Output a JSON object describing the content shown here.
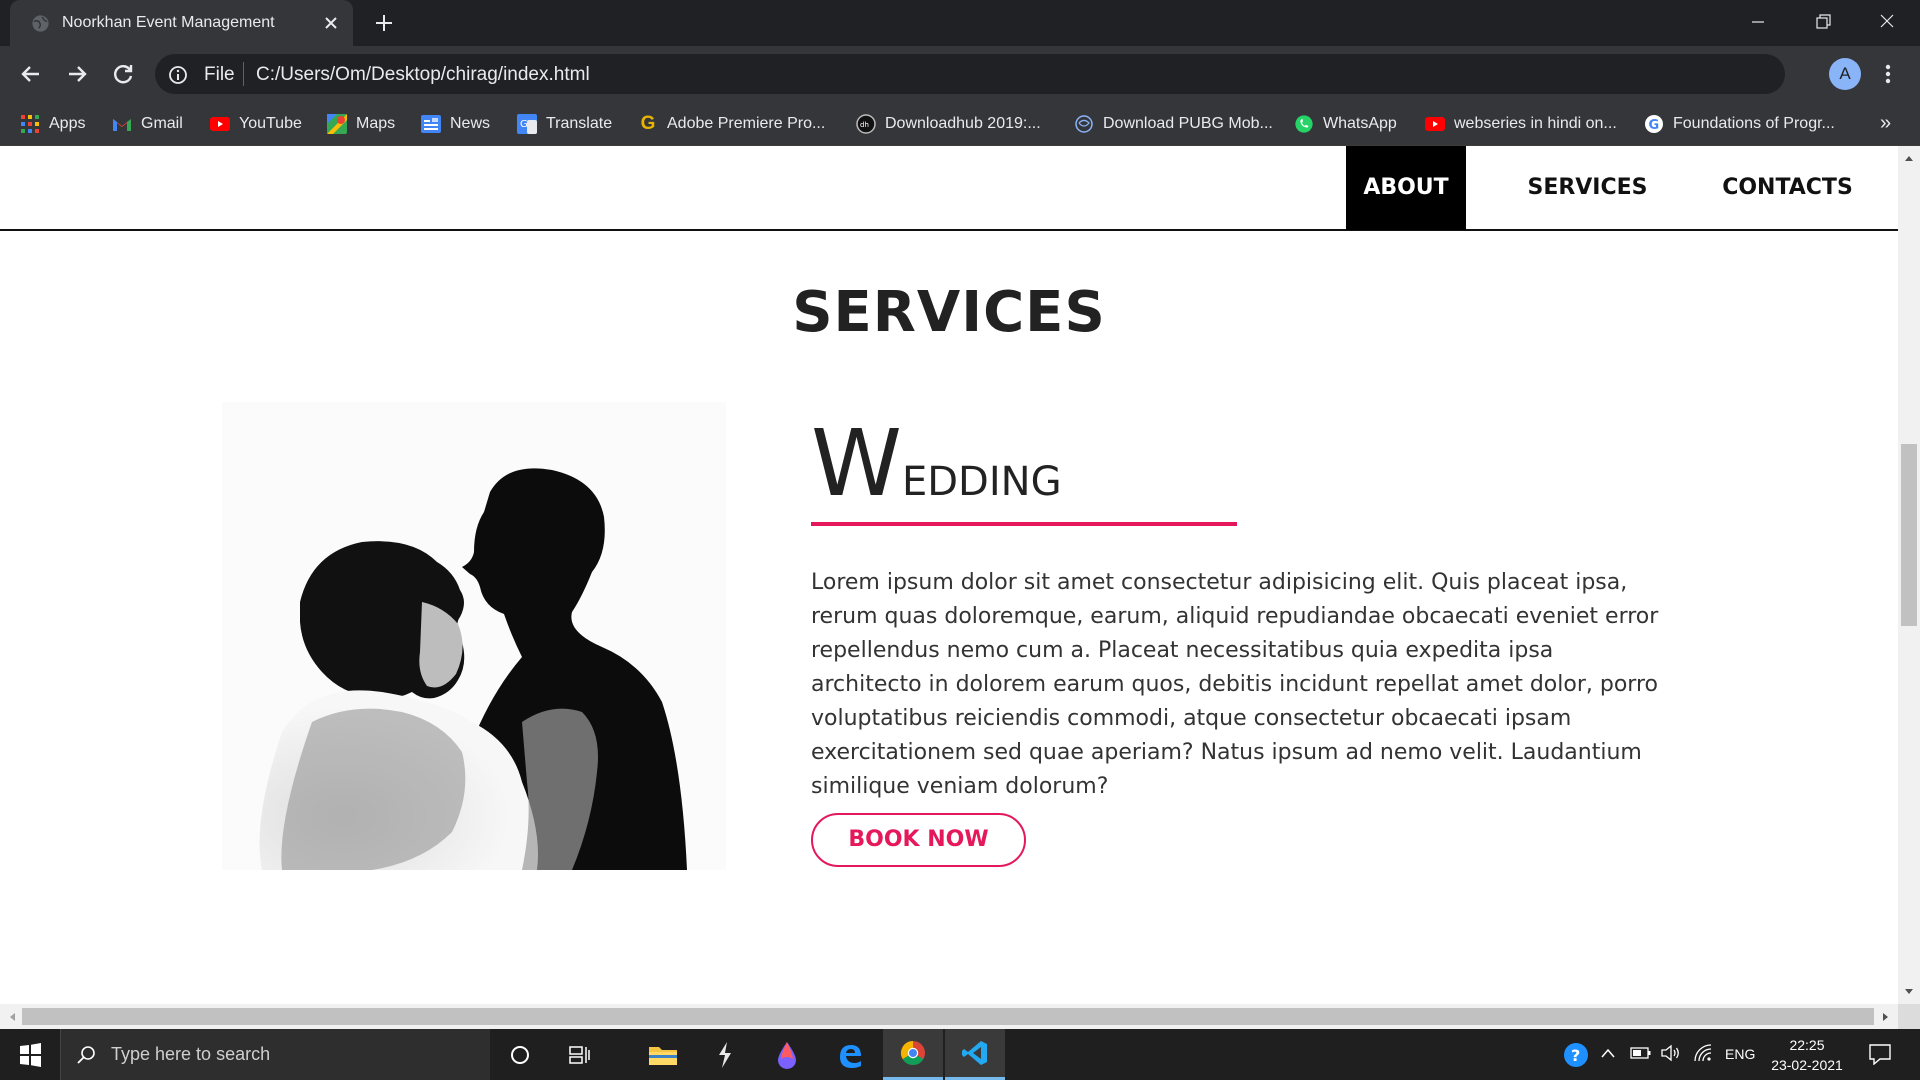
{
  "browser": {
    "tab_title": "Noorkhan Event Management",
    "scheme_label": "File",
    "url": "C:/Users/Om/Desktop/chirag/index.html",
    "avatar_letter": "A",
    "bookmarks": [
      {
        "label": "Apps",
        "icon": "apps-grid-icon"
      },
      {
        "label": "Gmail",
        "icon": "gmail-icon"
      },
      {
        "label": "YouTube",
        "icon": "youtube-icon"
      },
      {
        "label": "Maps",
        "icon": "maps-icon"
      },
      {
        "label": "News",
        "icon": "news-icon"
      },
      {
        "label": "Translate",
        "icon": "translate-icon"
      },
      {
        "label": "Adobe Premiere Pro...",
        "icon": "g-letter-icon"
      },
      {
        "label": "Downloadhub 2019:...",
        "icon": "downloadhub-icon"
      },
      {
        "label": "Download PUBG Mob...",
        "icon": "pubg-icon"
      },
      {
        "label": "WhatsApp",
        "icon": "whatsapp-icon"
      },
      {
        "label": "webseries in hindi on...",
        "icon": "youtube-icon"
      },
      {
        "label": "Foundations of Progr...",
        "icon": "google-icon"
      }
    ],
    "bookmarks_overflow": "»"
  },
  "site": {
    "nav": [
      "ABOUT",
      "SERVICES",
      "CONTACTS"
    ],
    "active_nav": "ABOUT",
    "section_title": "SERVICES",
    "service": {
      "heading_cap": "W",
      "heading_rest": "EDDING",
      "description": "Lorem ipsum dolor sit amet consectetur adipisicing elit. Quis placeat ipsa, rerum quas doloremque, earum, aliquid repudiandae obcaecati eveniet error repellendus nemo cum a. Placeat necessitatibus quia expedita ipsa architecto in dolorem earum quos, debitis incidunt repellat amet dolor, porro voluptatibus reiciendis commodi, atque consectetur obcaecati ipsam exercitationem sed quae aperiam? Natus ipsum ad nemo velit. Laudantium similique veniam dolorum?",
      "button_label": "BOOK NOW",
      "accent_color": "#e4185a"
    }
  },
  "taskbar": {
    "search_placeholder": "Type here to search",
    "language": "ENG",
    "time": "22:25",
    "date": "23-02-2021"
  }
}
